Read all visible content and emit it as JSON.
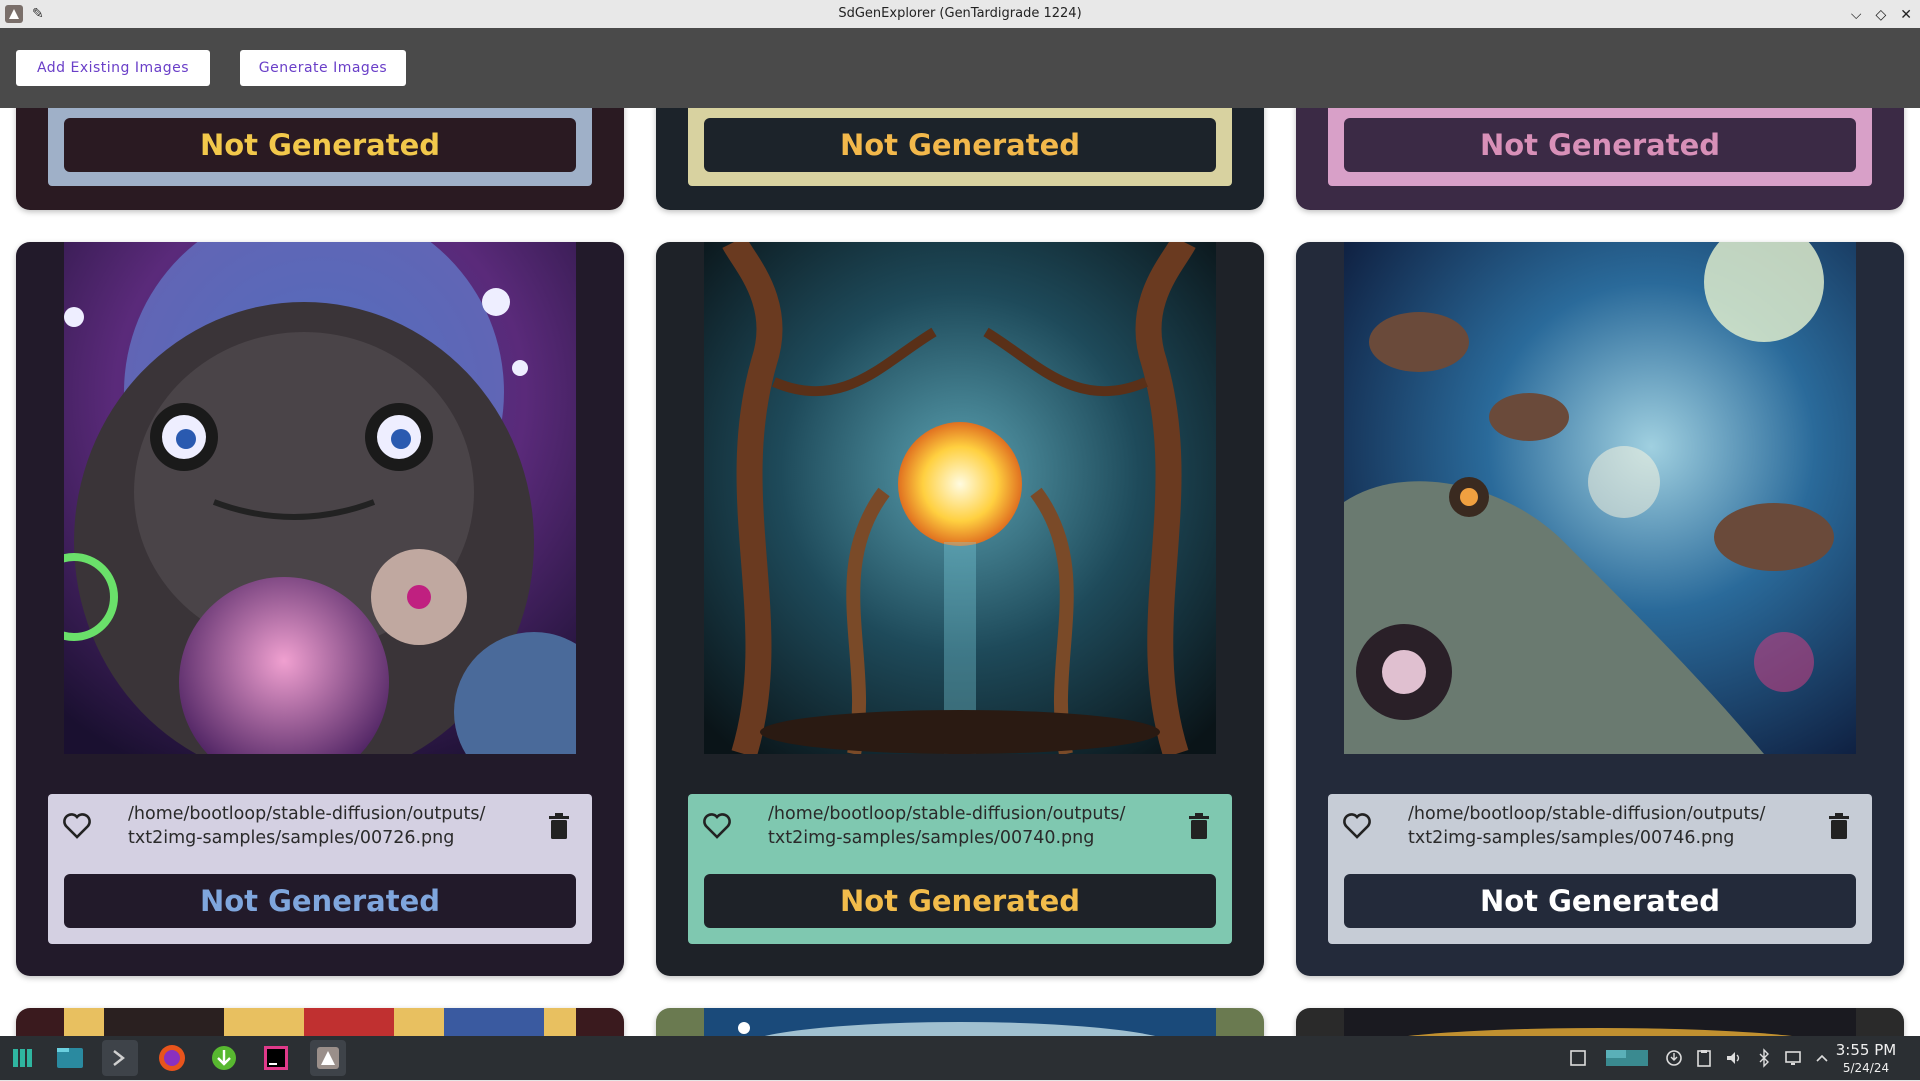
{
  "window": {
    "title": "SdGenExplorer (GenTardigrade 1224)",
    "controls": [
      "⌵",
      "◇",
      "✕"
    ]
  },
  "toolbar": {
    "add_existing_label": "Add Existing Images",
    "generate_label": "Generate Images"
  },
  "status_label": "Not Generated",
  "top_row_cards": [
    {
      "label": "Not Generated",
      "card_color": "#2a1a22",
      "panel_color": "#9fb0c8",
      "button_color": "#2a1a22",
      "text_color": "#f2c84b"
    },
    {
      "label": "Not Generated",
      "card_color": "#1c232a",
      "panel_color": "#d8d2a0",
      "button_color": "#1c232a",
      "text_color": "#f2b84b"
    },
    {
      "label": "Not Generated",
      "card_color": "#3b2a45",
      "panel_color": "#d8a0c8",
      "button_color": "#3b2a45",
      "text_color": "#d890b8"
    }
  ],
  "cards": [
    {
      "path": "/home/bootloop/stable-diffusion/outputs/\ntxt2img-samples/samples/00726.png",
      "label": "Not Generated",
      "image_subject": "cosmic tardigrade creature",
      "card_color": "#221a2a",
      "panel_color": "#d4d0e2",
      "button_color": "#221a2a",
      "text_color": "#7fa6dd"
    },
    {
      "path": "/home/bootloop/stable-diffusion/outputs/\ntxt2img-samples/samples/00740.png",
      "label": "Not Generated",
      "image_subject": "forest with glowing sun",
      "card_color": "#1e2228",
      "panel_color": "#7fc8b0",
      "button_color": "#1e2228",
      "text_color": "#f2bc4b"
    },
    {
      "path": "/home/bootloop/stable-diffusion/outputs/\ntxt2img-samples/samples/00746.png",
      "label": "Not Generated",
      "image_subject": "tardigrades floating in space",
      "card_color": "#232a3a",
      "panel_color": "#c6ccd6",
      "button_color": "#232a3a",
      "text_color": "#ffffff"
    }
  ],
  "bottom_row_cards": [
    {
      "card_color": "#3a1a1e"
    },
    {
      "card_color": "#6a7a50"
    },
    {
      "card_color": "#2a2a2a"
    }
  ],
  "taskbar": {
    "apps": [
      "menu-icon",
      "files-icon",
      "terminal-icon",
      "firefox-icon",
      "download-icon",
      "intellij-icon",
      "sdgenexplorer-icon"
    ],
    "tray": [
      "desktop-icon",
      "monitor-icon",
      "vpn-icon",
      "clipboard-icon",
      "volume-icon",
      "bluetooth-icon",
      "network-icon",
      "expand-icon"
    ],
    "time": "3:55 PM",
    "date": "5/24/24"
  }
}
